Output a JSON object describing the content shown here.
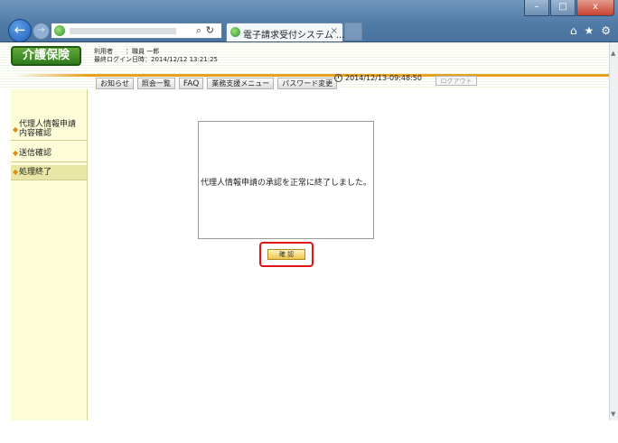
{
  "browser": {
    "address_search_icon": "search-icon",
    "address_refresh_icon": "refresh-icon",
    "tab_title": "電子請求受付システム ...",
    "tab_close": "×",
    "window_buttons": [
      "–",
      "□",
      "x"
    ],
    "chrome_icons": [
      "home-icon",
      "star-icon",
      "gear-icon"
    ]
  },
  "header": {
    "logo": "介護保険",
    "user_label": "利用者　　：職員 一郎",
    "last_login": "最終ログイン日時：2014/12/12 13:21:25",
    "datetime": "2014/12/13-09:48:50",
    "logout": "ログアウト"
  },
  "nav": [
    "お知らせ",
    "照会一覧",
    "FAQ",
    "業務支援メニュー",
    "パスワード変更"
  ],
  "sidebar": {
    "items": [
      {
        "label_line1": "代理人情報申請",
        "label_line2": "内容確認"
      },
      {
        "label": "送信確認"
      },
      {
        "label": "処理終了"
      }
    ],
    "arrow": "◆"
  },
  "main": {
    "message": "代理人情報申請の承認を正常に終了しました。",
    "confirm_button": "確 認"
  },
  "colors": {
    "accent_orange": "#e8a020",
    "logo_green": "#2f7a1c",
    "sidebar_bg": "#fdfcd8",
    "highlight_red": "#e01515",
    "chrome_blue": "#4f7aa6"
  }
}
